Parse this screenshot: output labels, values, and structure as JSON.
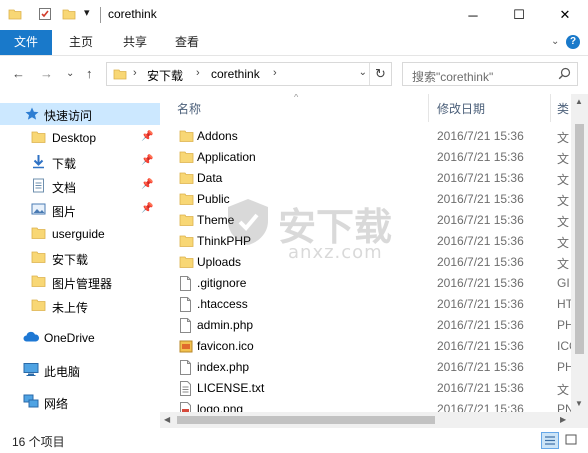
{
  "window": {
    "title": "corethink",
    "quick_access_dropdown": "▾",
    "minimize": "─",
    "maximize": "☐",
    "close": "✕"
  },
  "ribbon": {
    "tabs": [
      "文件",
      "主页",
      "共享",
      "查看"
    ],
    "expand": "⌄",
    "help": "?"
  },
  "nav": {
    "back": "←",
    "forward": "→",
    "recent": "⌄",
    "up": "↑",
    "breadcrumb": [
      "安下载",
      "corethink"
    ],
    "refresh": "↻",
    "search_placeholder": "搜索\"corethink\""
  },
  "sidebar": {
    "quick_access": "快速访问",
    "items": [
      {
        "label": "Desktop",
        "icon": "folder-icon",
        "pinned": true
      },
      {
        "label": "下载",
        "icon": "download-icon",
        "pinned": true
      },
      {
        "label": "文档",
        "icon": "document-icon",
        "pinned": true
      },
      {
        "label": "图片",
        "icon": "picture-icon",
        "pinned": true
      },
      {
        "label": "userguide",
        "icon": "folder-icon",
        "pinned": false
      },
      {
        "label": "安下载",
        "icon": "folder-icon",
        "pinned": false
      },
      {
        "label": "图片管理器",
        "icon": "folder-icon",
        "pinned": false
      },
      {
        "label": "未上传",
        "icon": "folder-icon",
        "pinned": false
      }
    ],
    "onedrive": "OneDrive",
    "this_pc": "此电脑",
    "network": "网络"
  },
  "columns": {
    "name": "名称",
    "date": "修改日期",
    "type": "类"
  },
  "files": [
    {
      "name": "Addons",
      "date": "2016/7/21 15:36",
      "type": "文",
      "icon": "folder-icon"
    },
    {
      "name": "Application",
      "date": "2016/7/21 15:36",
      "type": "文",
      "icon": "folder-icon"
    },
    {
      "name": "Data",
      "date": "2016/7/21 15:36",
      "type": "文",
      "icon": "folder-icon"
    },
    {
      "name": "Public",
      "date": "2016/7/21 15:36",
      "type": "文",
      "icon": "folder-icon"
    },
    {
      "name": "Theme",
      "date": "2016/7/21 15:36",
      "type": "文",
      "icon": "folder-icon"
    },
    {
      "name": "ThinkPHP",
      "date": "2016/7/21 15:36",
      "type": "文",
      "icon": "folder-icon"
    },
    {
      "name": "Uploads",
      "date": "2016/7/21 15:36",
      "type": "文",
      "icon": "folder-icon"
    },
    {
      "name": ".gitignore",
      "date": "2016/7/21 15:36",
      "type": "GI",
      "icon": "file-icon"
    },
    {
      "name": ".htaccess",
      "date": "2016/7/21 15:36",
      "type": "HT",
      "icon": "file-icon"
    },
    {
      "name": "admin.php",
      "date": "2016/7/21 15:36",
      "type": "PH",
      "icon": "file-icon"
    },
    {
      "name": "favicon.ico",
      "date": "2016/7/21 15:36",
      "type": "ICO",
      "icon": "ico-file-icon"
    },
    {
      "name": "index.php",
      "date": "2016/7/21 15:36",
      "type": "PH",
      "icon": "file-icon"
    },
    {
      "name": "LICENSE.txt",
      "date": "2016/7/21 15:36",
      "type": "文",
      "icon": "text-file-icon"
    },
    {
      "name": "logo.png",
      "date": "2016/7/21 15:36",
      "type": "PN",
      "icon": "image-file-icon"
    }
  ],
  "status": {
    "item_count": "16 个项目"
  },
  "watermark": {
    "cn": "安下载",
    "en": "anxz.com"
  }
}
